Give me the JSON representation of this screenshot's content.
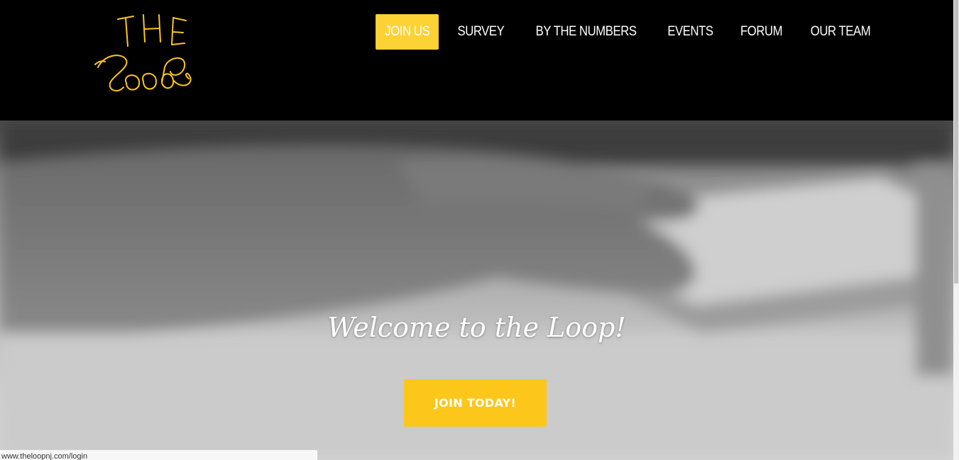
{
  "logo": {
    "alt": "THE Loop",
    "color": "#fdc61b"
  },
  "nav": {
    "items": [
      {
        "label": "JOIN US",
        "active": true
      },
      {
        "label": "SURVEY"
      },
      {
        "label": "BY THE NUMBERS"
      },
      {
        "label": "EVENTS"
      },
      {
        "label": "FORUM"
      },
      {
        "label": "OUR TEAM"
      }
    ],
    "active_color": "#fdd235"
  },
  "hero": {
    "headline": "Welcome to the Loop!",
    "cta_label": "JOIN TODAY!",
    "cta_color": "#fdc61b"
  },
  "status_bar": {
    "url": "www.theloopnj.com/login"
  }
}
